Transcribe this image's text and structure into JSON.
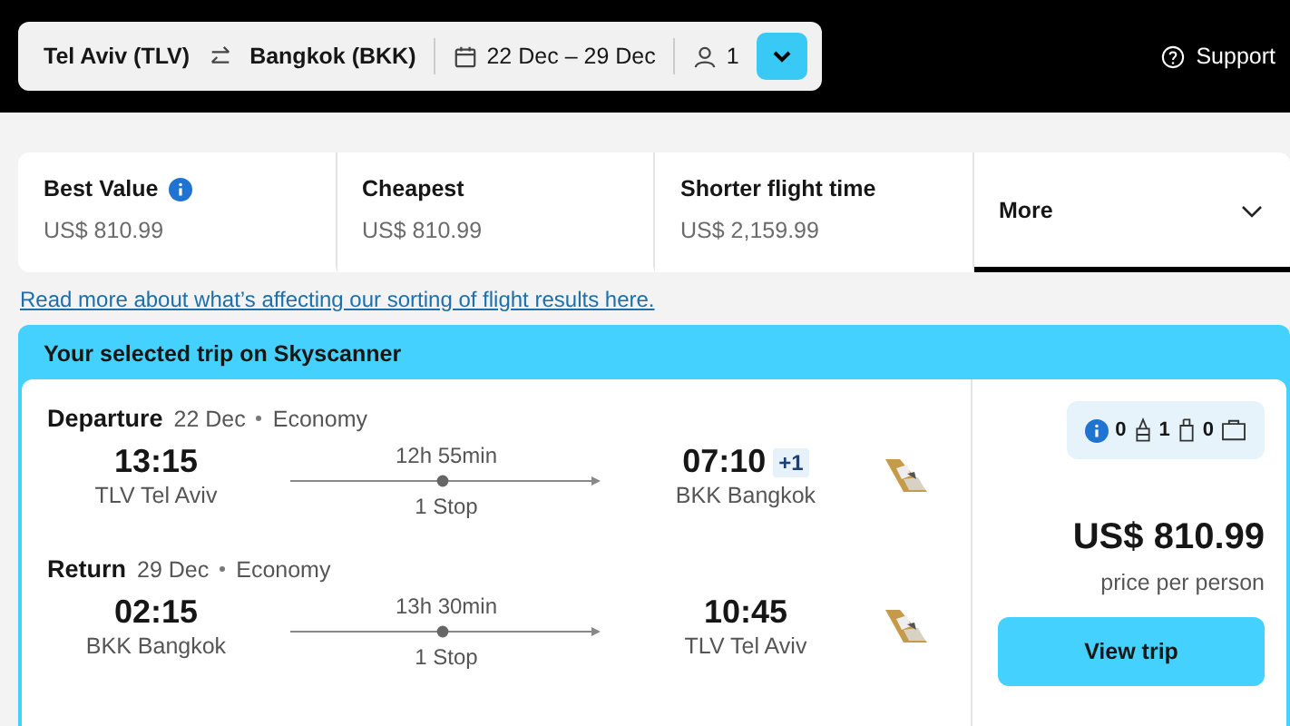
{
  "search": {
    "origin": "Tel Aviv (TLV)",
    "destination": "Bangkok (BKK)",
    "dates": "22 Dec – 29 Dec",
    "travellers": "1"
  },
  "support": "Support",
  "sort_tabs": [
    {
      "kind": "option",
      "label": "Best Value",
      "info": true,
      "price": "US$ 810.99",
      "selected": false
    },
    {
      "kind": "option",
      "label": "Cheapest",
      "info": false,
      "price": "US$ 810.99",
      "selected": false
    },
    {
      "kind": "option",
      "label": "Shorter flight time",
      "info": false,
      "price": "US$ 2,159.99",
      "selected": false
    },
    {
      "kind": "dropdown",
      "label": "More",
      "selected": true
    }
  ],
  "sorting_link": "Read more about what’s affecting our sorting of flight results here.",
  "trip": {
    "title": "Your selected trip on Skyscanner",
    "legs": [
      {
        "label": "Departure",
        "date": "22 Dec",
        "cabin": "Economy",
        "depart_time": "13:15",
        "depart_place": "TLV Tel Aviv",
        "duration": "12h 55min",
        "stops": "1 Stop",
        "arrive_time": "07:10",
        "day_offset": "+1",
        "arrive_place": "BKK Bangkok"
      },
      {
        "label": "Return",
        "date": "29 Dec",
        "cabin": "Economy",
        "depart_time": "02:15",
        "depart_place": "BKK Bangkok",
        "duration": "13h 30min",
        "stops": "1 Stop",
        "arrive_time": "10:45",
        "arrive_place": "TLV Tel Aviv"
      }
    ],
    "baggage": [
      {
        "kind": "personal",
        "count": "0"
      },
      {
        "kind": "cabin",
        "count": "1"
      },
      {
        "kind": "checked",
        "count": "0"
      }
    ],
    "price": "US$ 810.99",
    "price_note": "price per person",
    "button": "View trip"
  }
}
